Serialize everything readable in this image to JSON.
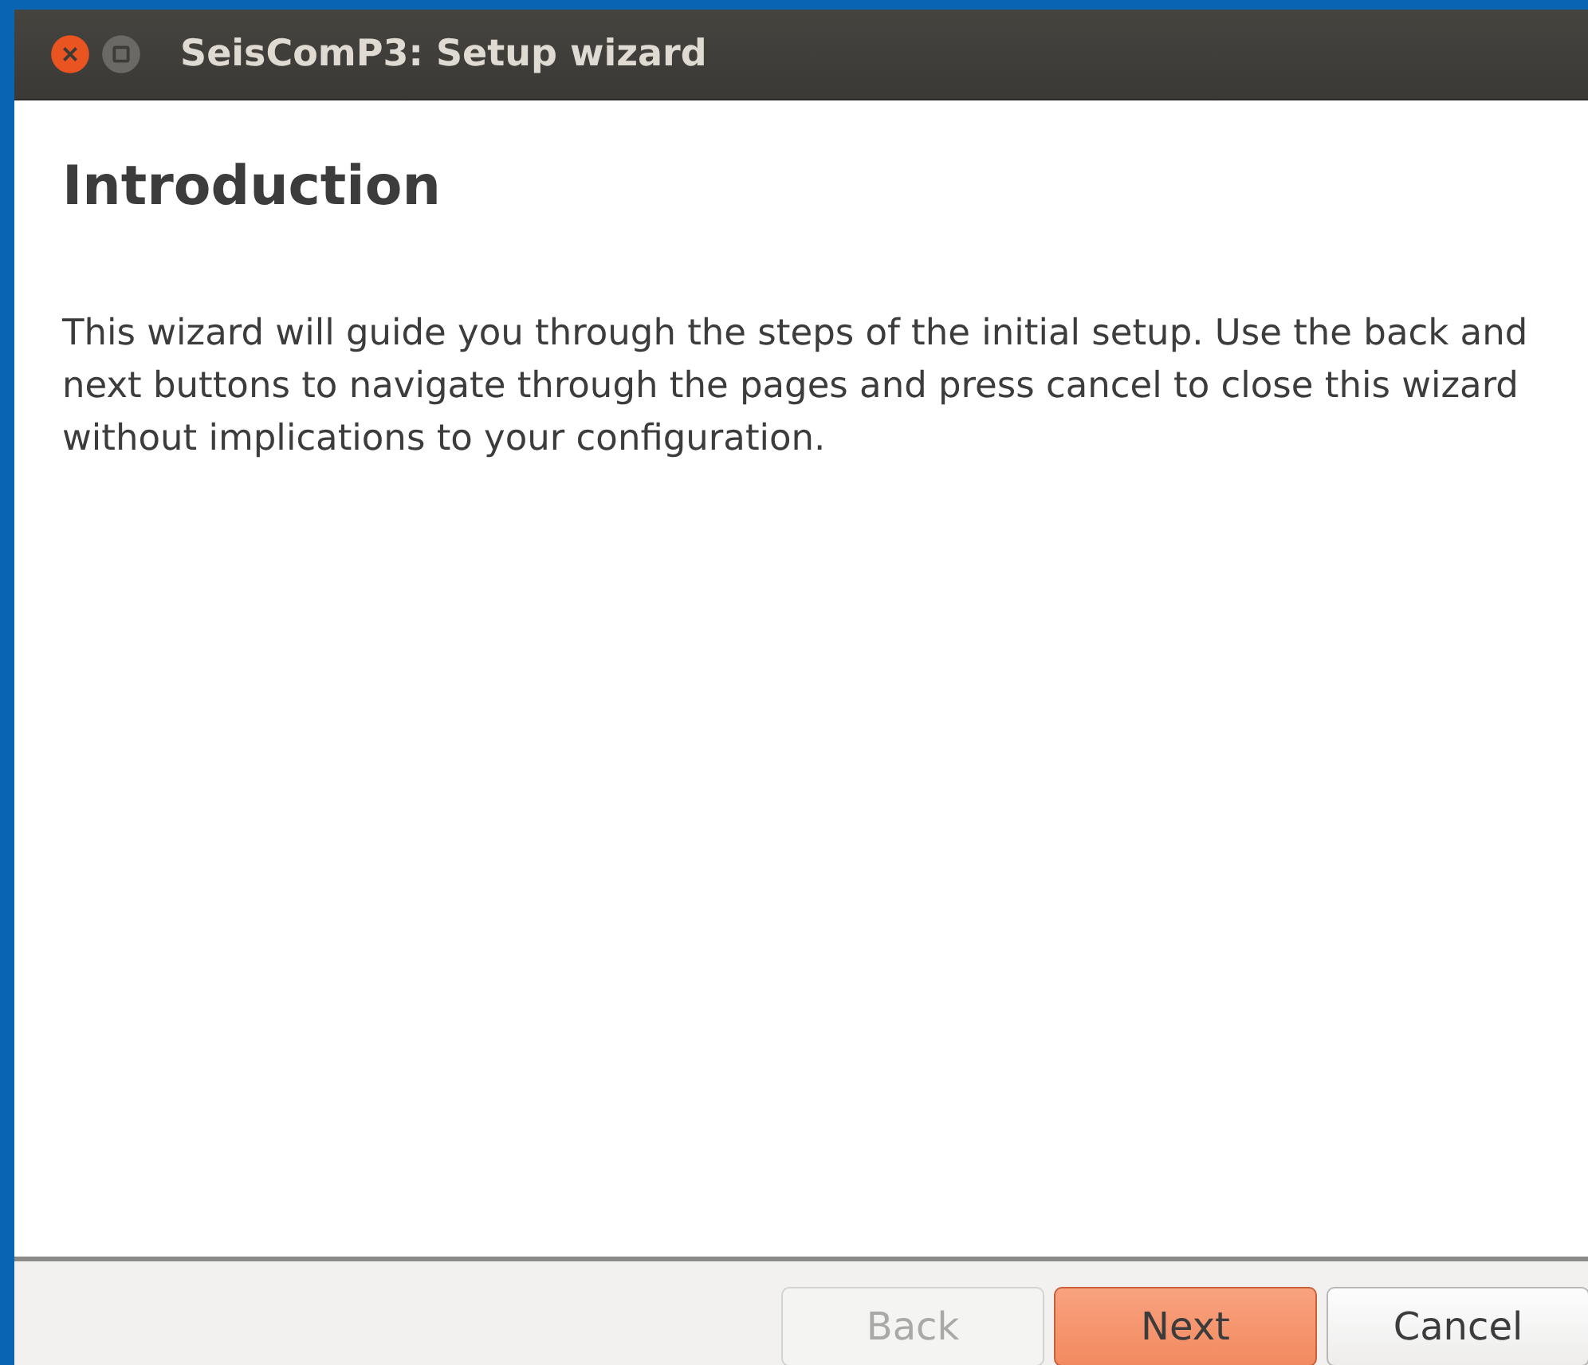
{
  "window": {
    "title": "SeisComP3: Setup wizard"
  },
  "page": {
    "title": "Introduction",
    "text": "This wizard will guide you through the steps of the initial setup. Use the back and next buttons to navigate through the pages and press cancel to close this wizard without implications to your configuration."
  },
  "buttons": [
    {
      "label": "Back",
      "disabled": true,
      "default": false
    },
    {
      "label": "Next",
      "disabled": false,
      "default": true
    },
    {
      "label": "Cancel",
      "disabled": false,
      "default": false
    }
  ]
}
